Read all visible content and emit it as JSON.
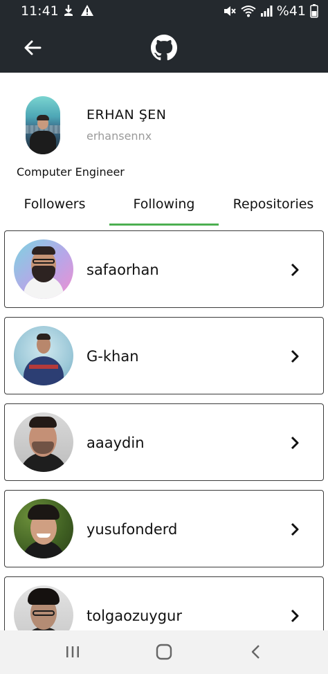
{
  "status_bar": {
    "time": "11:41",
    "battery_text": "%41",
    "icons": [
      "download-notification-icon",
      "warning-icon",
      "mute-icon",
      "wifi-icon",
      "signal-icon",
      "battery-icon"
    ]
  },
  "app_bar": {
    "back_icon": "arrow-left-icon",
    "logo_icon": "github-icon"
  },
  "profile": {
    "name": "ERHAN ŞEN",
    "login": "erhansennx",
    "bio": "Computer Engineer"
  },
  "tabs": [
    {
      "label": "Followers",
      "selected": false
    },
    {
      "label": "Following",
      "selected": true
    },
    {
      "label": "Repositories",
      "selected": false
    }
  ],
  "colors": {
    "app_bar": "#24292e",
    "tab_indicator": "#4caf50",
    "nav_bar": "#f2f2f2"
  },
  "following": [
    {
      "login": "safaorhan"
    },
    {
      "login": "G-khan"
    },
    {
      "login": "aaaydin"
    },
    {
      "login": "yusufonderd"
    },
    {
      "login": "tolgaozuygur"
    }
  ],
  "nav_bar": {
    "icons": [
      "recent-apps-icon",
      "home-icon",
      "back-nav-icon"
    ]
  }
}
